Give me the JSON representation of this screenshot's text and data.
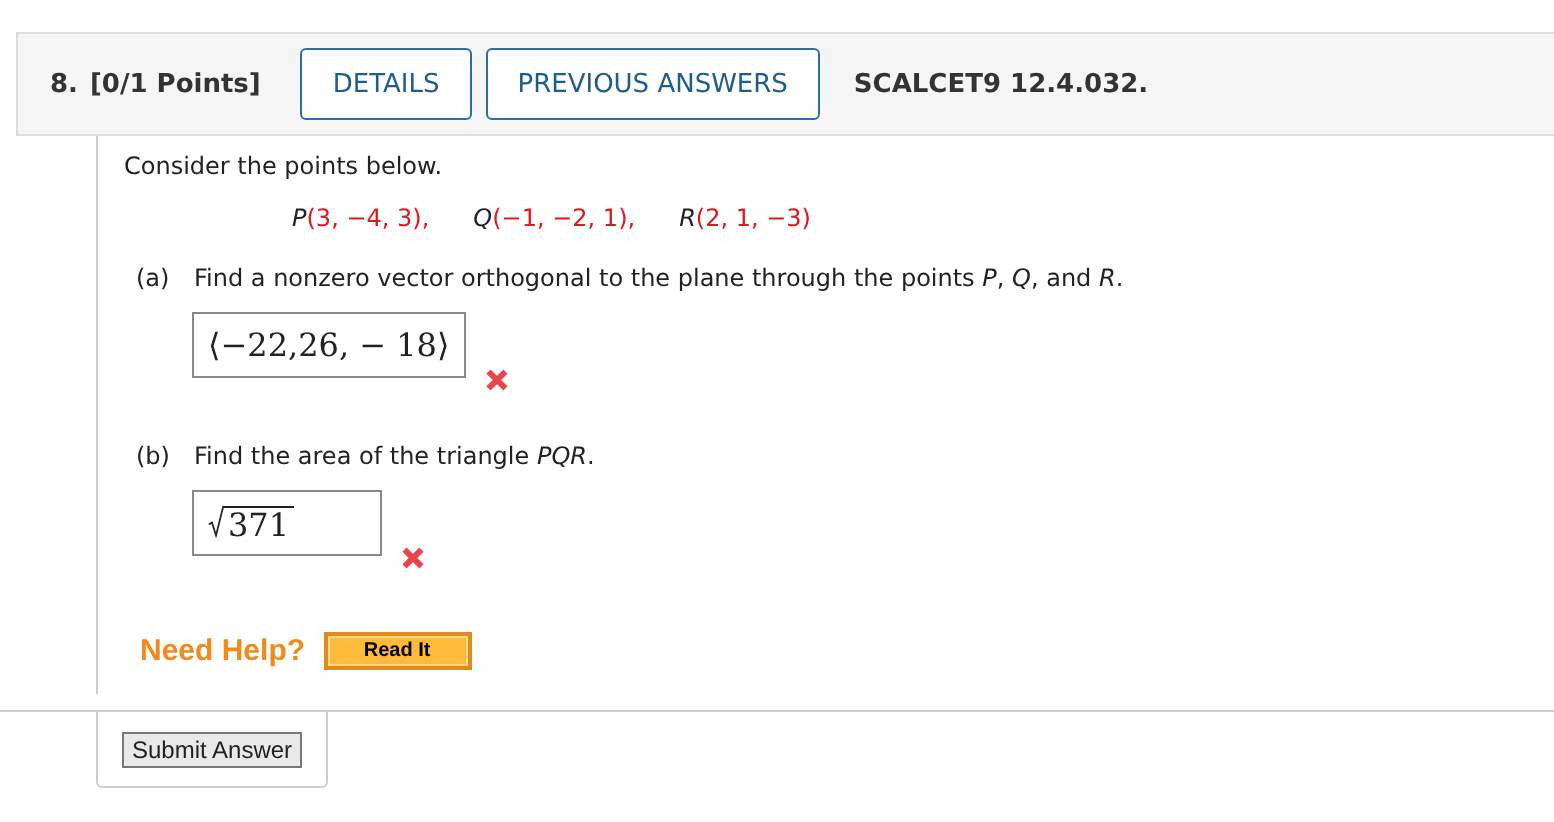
{
  "question": {
    "number": "8.",
    "points": "[0/1 Points]",
    "buttons": [
      "DETAILS",
      "PREVIOUS ANSWERS"
    ],
    "code": "SCALCET9 12.4.032."
  },
  "intro": "Consider the points below.",
  "points": [
    {
      "name": "P",
      "coords": "(3, −4, 3),"
    },
    {
      "name": "Q",
      "coords": "(−1, −2, 1),"
    },
    {
      "name": "R",
      "coords": "(2, 1, −3)"
    }
  ],
  "parts": [
    {
      "label": "(a)",
      "prompt": "Find a nonzero vector orthogonal to the plane through the points *P*, *Q*, and *R*.",
      "answer": {
        "kind": "vector",
        "value": "⟨−22,26, − 18⟩"
      },
      "correct": false
    },
    {
      "label": "(b)",
      "prompt": "Find the area of the triangle *PQR*.",
      "answer": {
        "kind": "sqrt",
        "value": "371"
      },
      "correct": false
    }
  ],
  "help": {
    "label": "Need Help?",
    "button": "Read It"
  },
  "submit": "Submit Answer"
}
